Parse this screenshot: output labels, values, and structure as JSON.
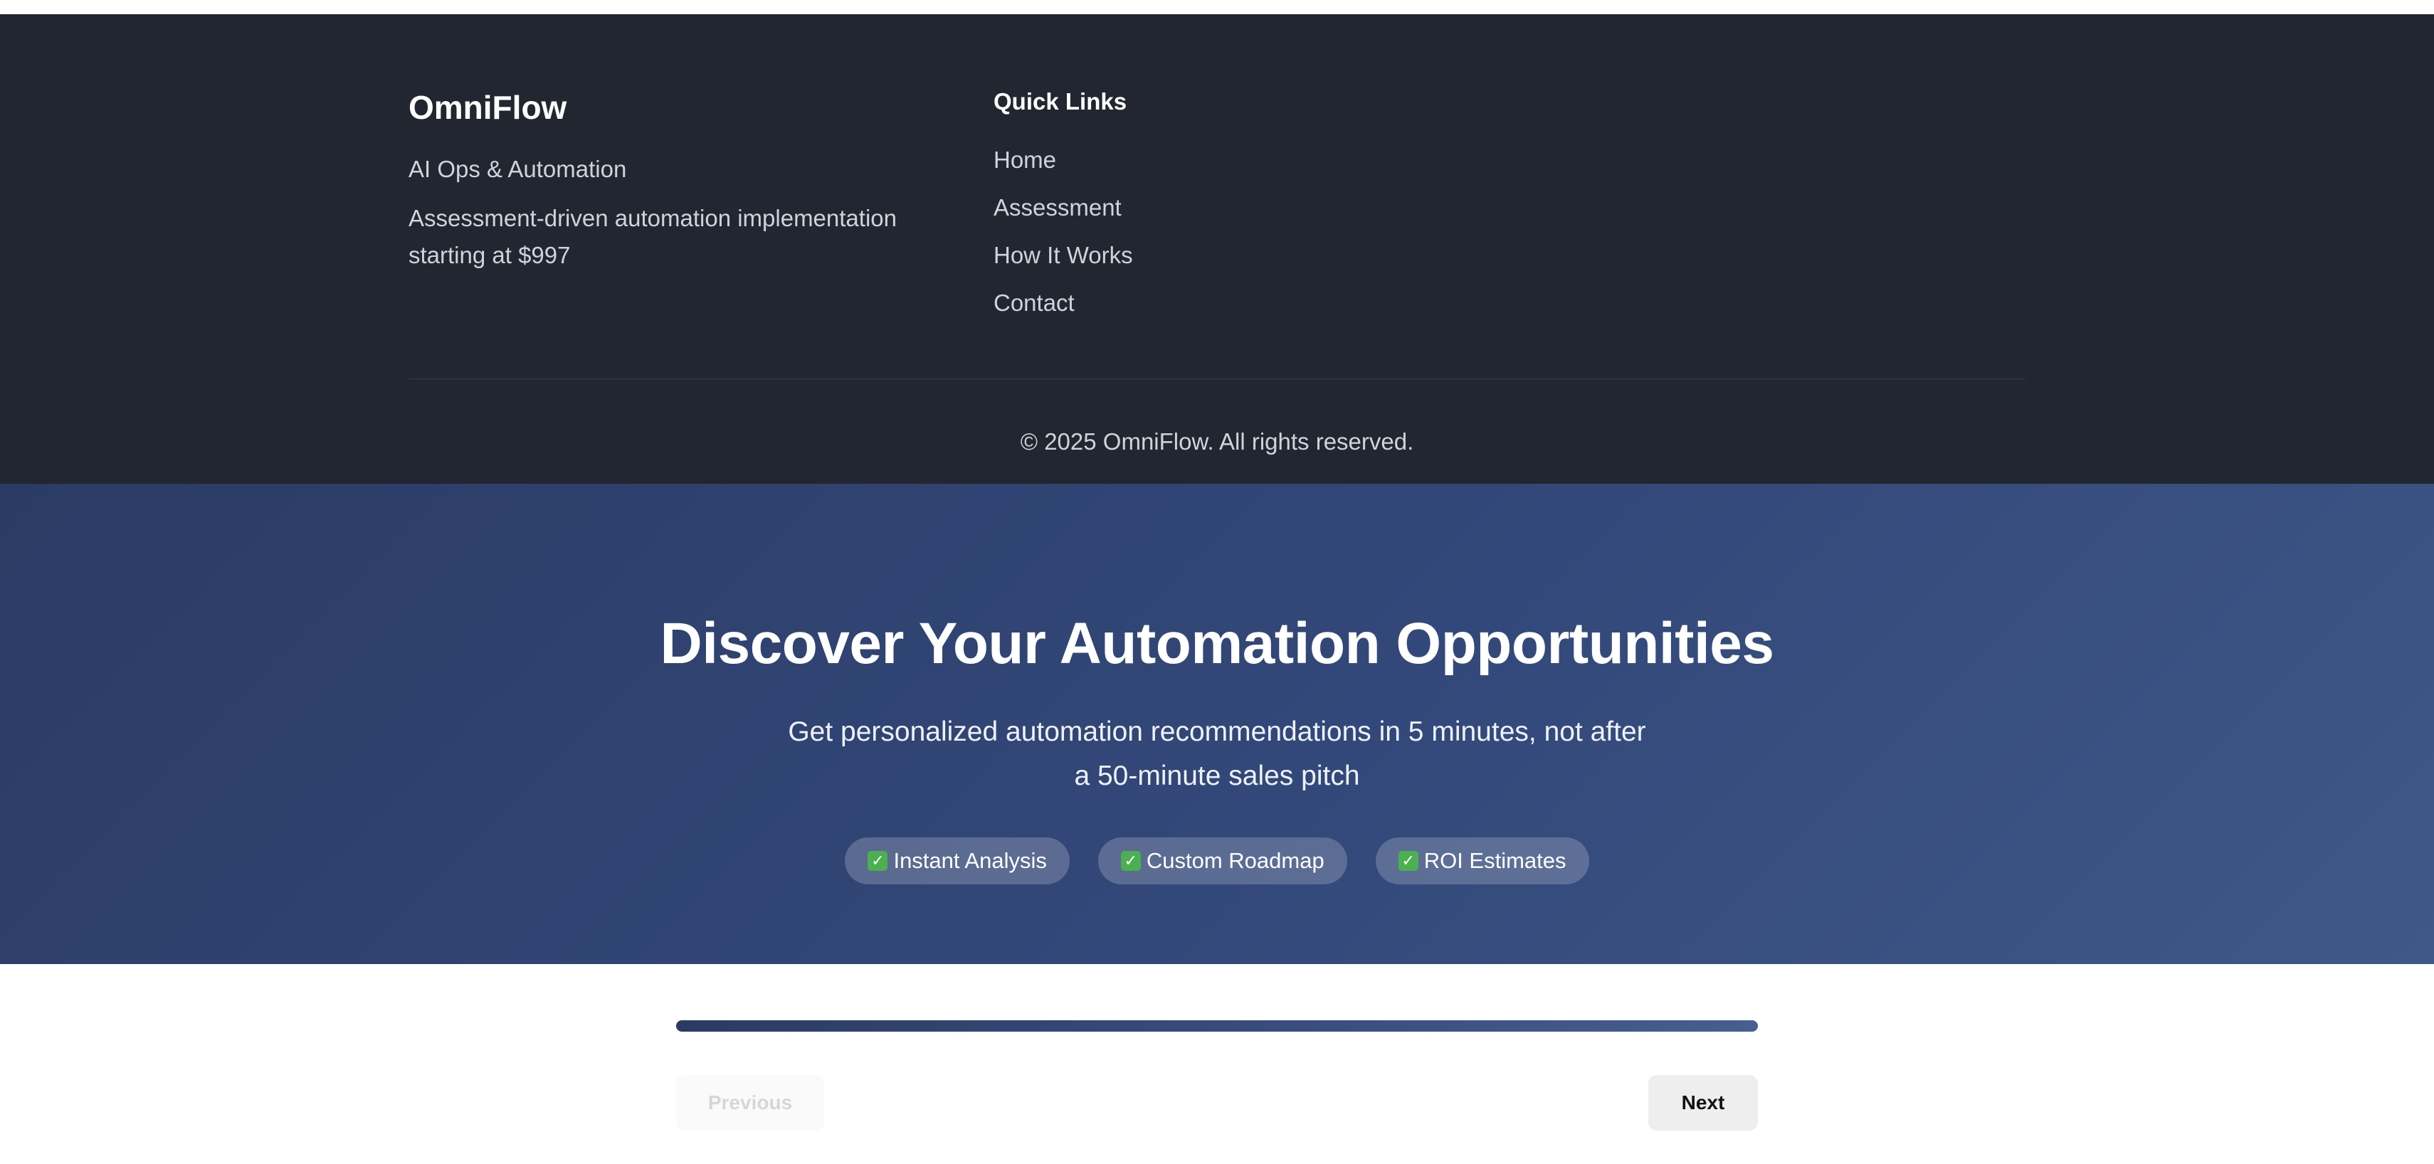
{
  "footer": {
    "brand": {
      "name": "OmniFlow",
      "tagline": "AI Ops & Automation",
      "description": "Assessment-driven automation implementation starting at $997"
    },
    "quick_links": {
      "title": "Quick Links",
      "items": [
        {
          "label": "Home"
        },
        {
          "label": "Assessment"
        },
        {
          "label": "How It Works"
        },
        {
          "label": "Contact"
        }
      ]
    },
    "copyright": "© 2025 OmniFlow. All rights reserved."
  },
  "hero": {
    "title": "Discover Your Automation Opportunities",
    "subtitle": "Get personalized automation recommendations in 5 minutes, not after a 50-minute sales pitch",
    "features": [
      {
        "icon": "check-box-icon",
        "label": "Instant Analysis"
      },
      {
        "icon": "check-box-icon",
        "label": "Custom Roadmap"
      },
      {
        "icon": "check-box-icon",
        "label": "ROI Estimates"
      }
    ]
  },
  "assessment": {
    "progress_percent": 100,
    "previous_label": "Previous",
    "next_label": "Next"
  },
  "colors": {
    "footer_bg": "#222630",
    "hero_bg_start": "#2b3b64",
    "hero_bg_end": "#3e5887",
    "check_green": "#4caf50"
  }
}
